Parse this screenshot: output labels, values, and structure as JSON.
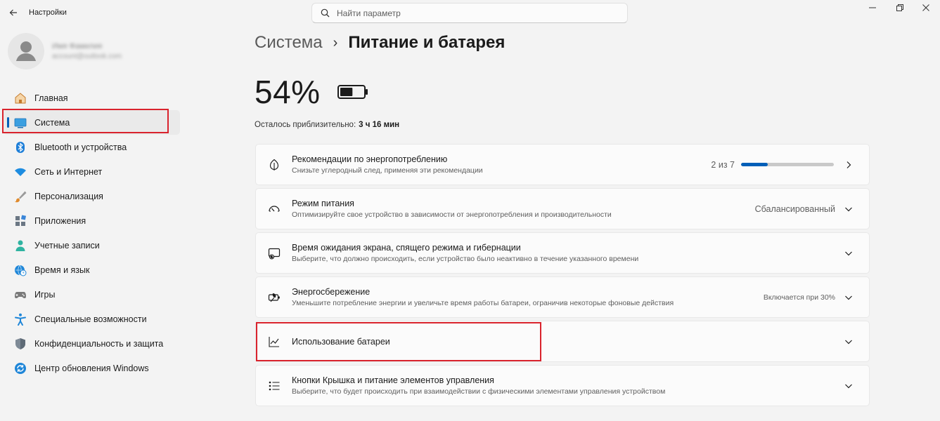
{
  "app": {
    "title": "Настройки"
  },
  "search": {
    "placeholder": "Найти параметр"
  },
  "profile": {
    "name": "Имя Фамилия",
    "email": "account@outlook.com"
  },
  "sidebar": {
    "items": [
      {
        "label": "Главная",
        "icon": "home-icon"
      },
      {
        "label": "Система",
        "icon": "monitor-icon",
        "active": true
      },
      {
        "label": "Bluetooth и устройства",
        "icon": "bluetooth-icon"
      },
      {
        "label": "Сеть и Интернет",
        "icon": "wifi-icon"
      },
      {
        "label": "Персонализация",
        "icon": "brush-icon"
      },
      {
        "label": "Приложения",
        "icon": "apps-icon"
      },
      {
        "label": "Учетные записи",
        "icon": "person-icon"
      },
      {
        "label": "Время и язык",
        "icon": "globe-clock-icon"
      },
      {
        "label": "Игры",
        "icon": "gamepad-icon"
      },
      {
        "label": "Специальные возможности",
        "icon": "accessibility-icon"
      },
      {
        "label": "Конфиденциальность и защита",
        "icon": "shield-icon"
      },
      {
        "label": "Центр обновления Windows",
        "icon": "update-icon"
      }
    ]
  },
  "breadcrumb": {
    "parent": "Система",
    "separator": "›",
    "current": "Питание и батарея"
  },
  "battery": {
    "percent_label": "54%",
    "level": 0.54,
    "remaining_label": "Осталось приблизительно:",
    "remaining_value": "3 ч 16 мин"
  },
  "cards": [
    {
      "title": "Рекомендации по энергопотреблению",
      "subtitle": "Снизьте углеродный след, применяя эти рекомендации",
      "value": "2 из 7",
      "progress": 0.2857,
      "icon": "leaf-icon"
    },
    {
      "title": "Режим питания",
      "subtitle": "Оптимизируйте свое устройство в зависимости от энергопотребления и производительности",
      "value": "Сбалансированный",
      "icon": "gauge-icon"
    },
    {
      "title": "Время ожидания экрана, спящего режима и гибернации",
      "subtitle": "Выберите, что должно происходить, если устройство было неактивно в течение указанного времени",
      "icon": "screen-sleep-icon"
    },
    {
      "title": "Энергосбережение",
      "subtitle": "Уменьшите потребление энергии и увеличьте время работы батареи, ограничив некоторые фоновые действия",
      "value": "Включается при 30%",
      "icon": "battery-saver-icon"
    },
    {
      "title": "Использование батареи",
      "icon": "chart-line-icon"
    },
    {
      "title": "Кнопки Крышка и питание элементов управления",
      "subtitle": "Выберите, что будет происходить при взаимодействии с физическими элементами управления устройством",
      "icon": "list-icon"
    }
  ],
  "colors": {
    "accent": "#005fb8",
    "highlight": "#d9232d"
  }
}
